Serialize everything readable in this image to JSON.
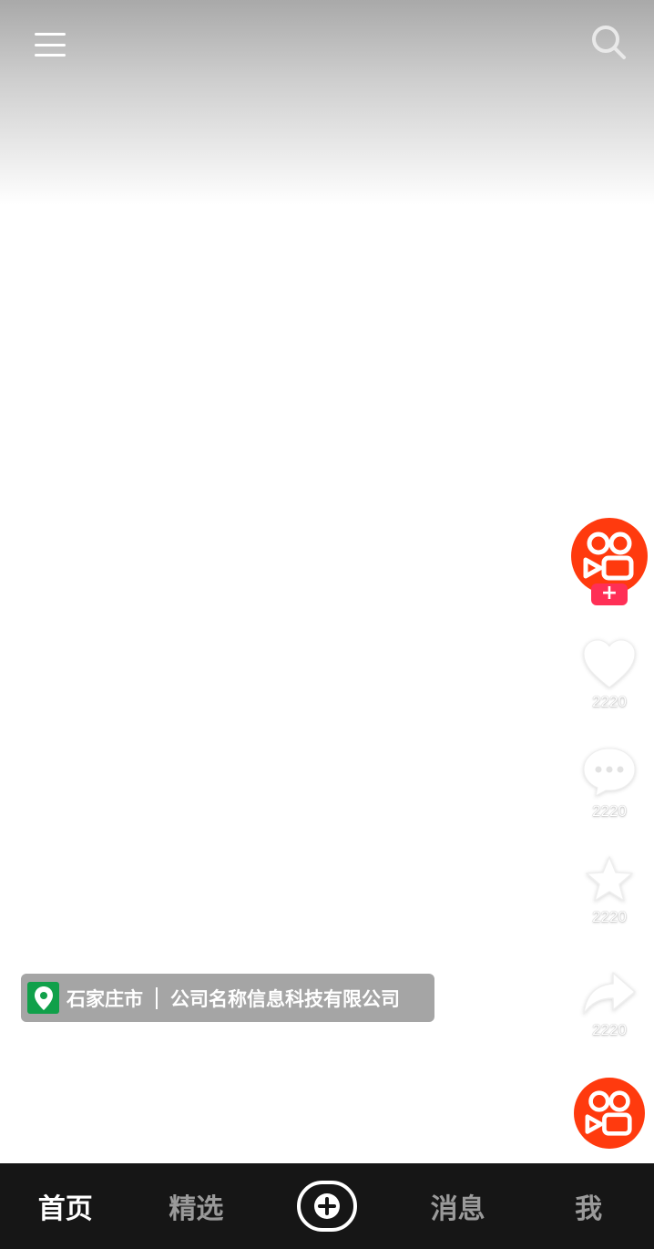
{
  "location": {
    "city": "石家庄市",
    "company": "公司名称信息科技有限公司"
  },
  "actions": {
    "like_count": "2220",
    "comment_count": "2220",
    "favorite_count": "2220",
    "share_count": "2220"
  },
  "follow_label": "+",
  "nav": {
    "home": "首页",
    "featured": "精选",
    "messages": "消息",
    "me": "我"
  },
  "colors": {
    "brand_orange": "#ff3a0e",
    "follow_pink": "#ff2f56",
    "location_green": "#10a04a",
    "nav_background": "#161616"
  },
  "icons": [
    "menu-icon",
    "search-icon",
    "kuaishou-logo",
    "heart-icon",
    "comment-icon",
    "star-icon",
    "share-icon",
    "location-pin-icon",
    "plus-circle-icon"
  ]
}
